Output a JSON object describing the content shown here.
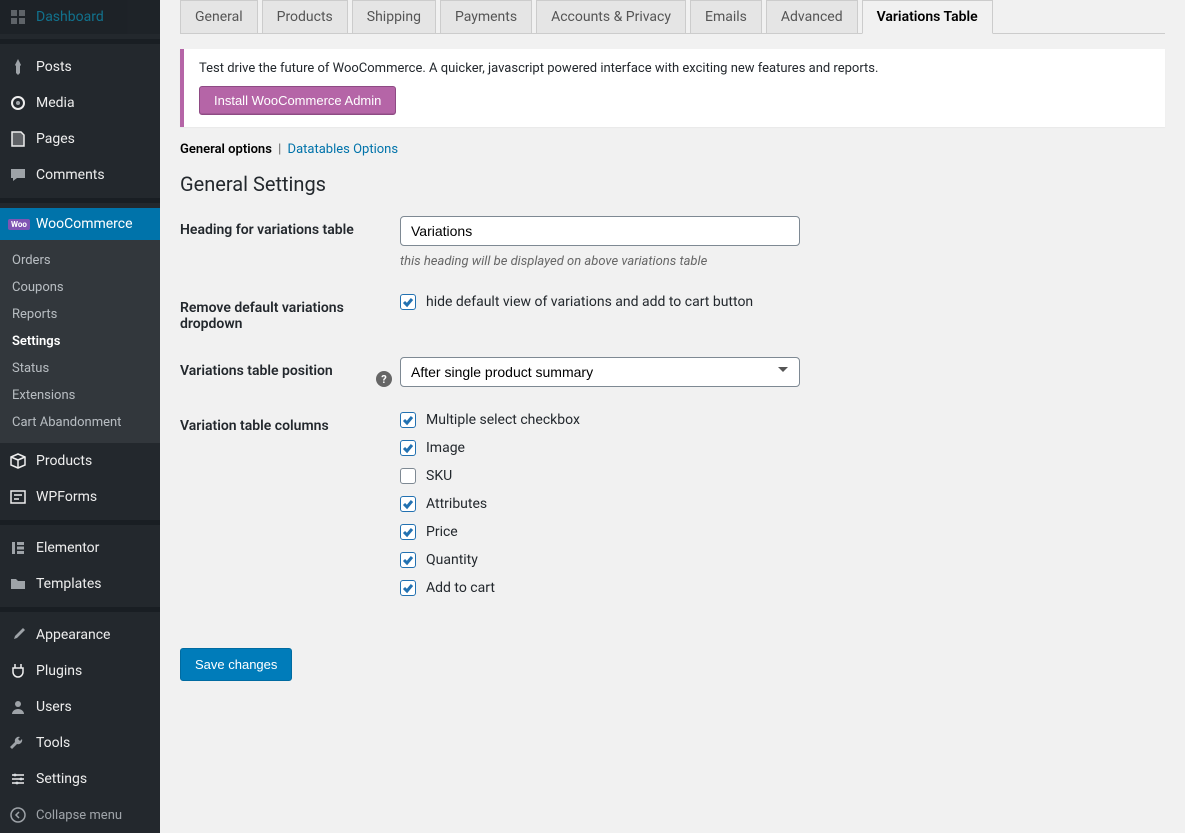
{
  "sidebar": {
    "items": [
      {
        "label": "Dashboard",
        "icon": "dashboard"
      },
      {
        "label": "Posts",
        "icon": "pin"
      },
      {
        "label": "Media",
        "icon": "media"
      },
      {
        "label": "Pages",
        "icon": "pages"
      },
      {
        "label": "Comments",
        "icon": "comments"
      },
      {
        "label": "WooCommerce",
        "icon": "woo",
        "active": true
      },
      {
        "label": "Products",
        "icon": "box"
      },
      {
        "label": "WPForms",
        "icon": "form"
      },
      {
        "label": "Elementor",
        "icon": "elementor"
      },
      {
        "label": "Templates",
        "icon": "folder"
      },
      {
        "label": "Appearance",
        "icon": "brush"
      },
      {
        "label": "Plugins",
        "icon": "plug"
      },
      {
        "label": "Users",
        "icon": "user"
      },
      {
        "label": "Tools",
        "icon": "wrench"
      },
      {
        "label": "Settings",
        "icon": "sliders"
      }
    ],
    "submenu": [
      {
        "label": "Orders"
      },
      {
        "label": "Coupons"
      },
      {
        "label": "Reports"
      },
      {
        "label": "Settings",
        "current": true
      },
      {
        "label": "Status"
      },
      {
        "label": "Extensions"
      },
      {
        "label": "Cart Abandonment"
      }
    ],
    "collapse": "Collapse menu"
  },
  "tabs": [
    {
      "label": "General"
    },
    {
      "label": "Products"
    },
    {
      "label": "Shipping"
    },
    {
      "label": "Payments"
    },
    {
      "label": "Accounts & Privacy"
    },
    {
      "label": "Emails"
    },
    {
      "label": "Advanced"
    },
    {
      "label": "Variations Table",
      "active": true
    }
  ],
  "notice": {
    "text": "Test drive the future of WooCommerce. A quicker, javascript powered interface with exciting new features and reports.",
    "button": "Install WooCommerce Admin"
  },
  "subsub": {
    "current": "General options",
    "link": "Datatables Options"
  },
  "section_title": "General Settings",
  "fields": {
    "heading": {
      "label": "Heading for variations table",
      "value": "Variations",
      "desc": "this heading will be displayed on above variations table"
    },
    "remove": {
      "label": "Remove default variations dropdown",
      "checkbox_label": "hide default view of variations and add to cart button",
      "checked": true
    },
    "position": {
      "label": "Variations table position",
      "value": "After single product summary"
    },
    "columns": {
      "label": "Variation table columns",
      "options": [
        {
          "label": "Multiple select checkbox",
          "checked": true
        },
        {
          "label": "Image",
          "checked": true
        },
        {
          "label": "SKU",
          "checked": false
        },
        {
          "label": "Attributes",
          "checked": true
        },
        {
          "label": "Price",
          "checked": true
        },
        {
          "label": "Quantity",
          "checked": true
        },
        {
          "label": "Add to cart",
          "checked": true
        }
      ]
    }
  },
  "save": "Save changes"
}
